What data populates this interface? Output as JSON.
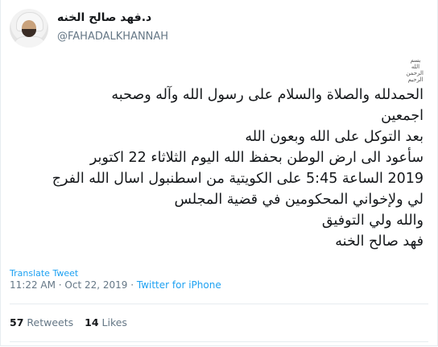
{
  "author": {
    "display_name": "د.فهد صالح الخنه",
    "handle": "@FAHADALKHANNAH"
  },
  "tweet": {
    "basmala": "بسم الله الرحمن الرحيم",
    "lines": [
      "الحمدلله والصلاة والسلام على رسول الله وآله وصحبه",
      "اجمعين",
      "بعد التوكل على الله وبعون الله",
      "سأعود الى ارض الوطن بحفظ الله اليوم الثلاثاء 22 اكتوبر",
      "2019 الساعة 5:45 على الكويتية من اسطنبول اسال الله الفرج",
      "لي ولإخواني المحكومين في قضية المجلس",
      "والله ولي التوفيق",
      "فهد صالح الخنه"
    ]
  },
  "translate_label": "Translate Tweet",
  "timestamp": "11:22 AM · Oct 22, 2019 · ",
  "source": "Twitter for iPhone",
  "stats": {
    "retweets_count": "57",
    "retweets_label": "Retweets",
    "likes_count": "14",
    "likes_label": "Likes"
  }
}
